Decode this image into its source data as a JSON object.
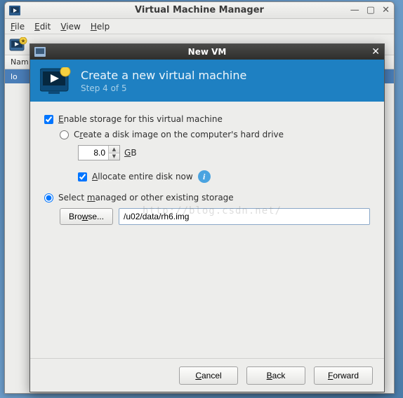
{
  "main_window": {
    "title": "Virtual Machine Manager",
    "menus": {
      "file": "File",
      "edit": "Edit",
      "view": "View",
      "help": "Help"
    },
    "list_header": "Nam",
    "list_row": "lo"
  },
  "dialog": {
    "title": "New VM",
    "header_title": "Create a new virtual machine",
    "header_step": "Step 4 of 5",
    "enable_storage": "Enable storage for this virtual machine",
    "create_disk": "Create a disk image on the computer's hard drive",
    "size_value": "8.0",
    "size_unit": "GB",
    "allocate_now": "Allocate entire disk now",
    "select_managed": "Select managed or other existing storage",
    "browse_label": "Browse...",
    "path_value": "/u02/data/rh6.img",
    "buttons": {
      "cancel": "Cancel",
      "back": "Back",
      "forward": "Forward"
    }
  },
  "watermark": "http://blog.csdn.net/"
}
